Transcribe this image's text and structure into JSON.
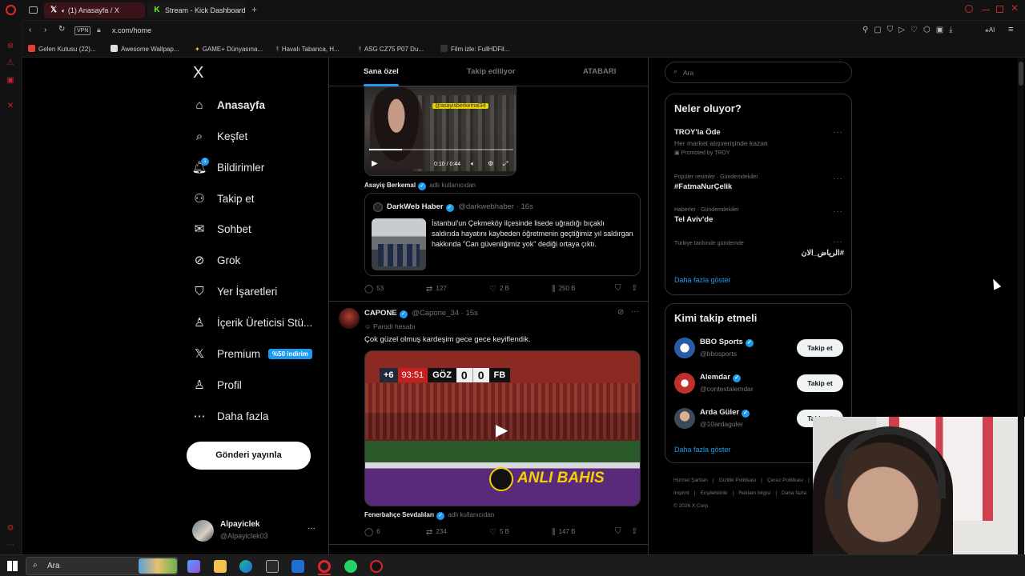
{
  "browser": {
    "tabs": [
      {
        "label": "(1) Anasayfa / X",
        "active": true
      },
      {
        "label": "Stream - Kick Dashboard",
        "active": false
      }
    ],
    "new_tab": "+",
    "url": "x.com/home",
    "vpn": "VPN",
    "ai_label": "AI",
    "bookmarks": [
      "Gelen Kutusu (22)...",
      "Awesome Wallpap...",
      "GAME+ Dünyasına...",
      "Havalı Tabanca, H...",
      "ASG CZ75 P07 Du...",
      "Film izle: FullHDFil..."
    ]
  },
  "nav": {
    "logo": "X",
    "items": [
      {
        "label": "Anasayfa",
        "icon": "home-icon",
        "glyph": "⌂"
      },
      {
        "label": "Keşfet",
        "icon": "search-icon",
        "glyph": "⌕"
      },
      {
        "label": "Bildirimler",
        "icon": "bell-icon",
        "glyph": "🔔︎"
      },
      {
        "label": "Takip et",
        "icon": "follow-person-icon",
        "glyph": "⚇"
      },
      {
        "label": "Sohbet",
        "icon": "mail-icon",
        "glyph": "✉"
      },
      {
        "label": "Grok",
        "icon": "grok-icon",
        "glyph": "⊘"
      },
      {
        "label": "Yer İşaretleri",
        "icon": "bookmark-icon",
        "glyph": "⛉"
      },
      {
        "label": "İçerik Üreticisi Stü...",
        "icon": "creator-studio-icon",
        "glyph": "♙"
      },
      {
        "label": "Premium",
        "icon": "x-premium-icon",
        "glyph": "𝕏"
      },
      {
        "label": "Profil",
        "icon": "profile-icon",
        "glyph": "♙"
      },
      {
        "label": "Daha fazla",
        "icon": "more-circle-icon",
        "glyph": "⋯"
      }
    ],
    "premium_badge": "%50 indirim",
    "notification_count": "1",
    "post_button": "Gönderi yayınla",
    "account": {
      "name": "Alpayiclek",
      "handle": "@Alpayiclek03"
    }
  },
  "timeline": {
    "tabs": [
      "Sana özel",
      "Takip ediliyor",
      "ATABARI"
    ],
    "tweet1": {
      "video_overlay_tag": "@asayisberkemal34",
      "video_time": "0:10 / 0:44",
      "attribution_name": "Asayiş Berkemal",
      "attribution_suffix": "adlı kullanıcıdan",
      "quote": {
        "name": "DarkWeb Haber",
        "handle": "@darkwebhaber",
        "time": "· 16s",
        "text": "İstanbul'un Çekmeköy ilçesinde lisede uğradığı bıçaklı saldırıda hayatını kaybeden öğretmenin geçtiğimiz yıl saldırgan hakkında \"Can güvenliğimiz yok\" dediği ortaya çıktı."
      },
      "stats": {
        "replies": "53",
        "reposts": "127",
        "likes": "2 B",
        "views": "250 B"
      }
    },
    "tweet2": {
      "name": "CAPONE",
      "handle": "@Capone_34",
      "time": "· 15s",
      "parody": "Parodi hesabı",
      "text": "Çok güzel olmuş kardeşim gece gece keyiflendik.",
      "scoreboard": {
        "plus": "+6",
        "clock": "93:51",
        "home": "GÖZ",
        "home_score": "0",
        "away_score": "0",
        "away": "FB"
      },
      "pitch_text": "ANLI BAHIS",
      "attribution_name": "Fenerbahçe Sevdalıları",
      "attribution_suffix": "adlı kullanıcıdan",
      "stats": {
        "replies": "6",
        "reposts": "234",
        "likes": "5 B",
        "views": "147 B"
      }
    }
  },
  "right": {
    "search_placeholder": "Ara",
    "trends": {
      "title": "Neler oluyor?",
      "items": [
        {
          "meta": "",
          "title": "TROY'la Öde",
          "sub": "Her market alışverişinde kazan",
          "promo": "Promoted by TROY"
        },
        {
          "meta": "Popüler resimler · Gündemdekiler",
          "title": "#FatmaNurÇelik"
        },
        {
          "meta": "Haberler · Gündemdekiler",
          "title": "Tel Aviv'de"
        },
        {
          "meta": "Türkiye tarihinde gündemde",
          "title": "#الرياض_الان"
        }
      ],
      "show_more": "Daha fazla göster"
    },
    "who_to_follow": {
      "title": "Kimi takip etmeli",
      "users": [
        {
          "name": "BBO Sports",
          "handle": "@bbosports"
        },
        {
          "name": "Alemdar",
          "handle": "@contextalemdar"
        },
        {
          "name": "Arda Güler",
          "handle": "@10ardaguler"
        }
      ],
      "follow_label": "Takip et",
      "show_more": "Daha fazla göster"
    },
    "footer": {
      "links": [
        "Hizmet Şartları",
        "|",
        "Gizlilik Politikası",
        "|",
        "Çerez Politikası",
        "|"
      ],
      "links2": [
        "Imprint",
        "|",
        "Erişilebilirlik",
        "|",
        "Reklam bilgisi",
        "|",
        "Daha fazla"
      ],
      "copyright": "© 2026 X Corp."
    }
  },
  "taskbar": {
    "search_placeholder": "Ara"
  },
  "colors": {
    "accent": "#1d9bf0",
    "opera_red": "#c2282e",
    "background": "#000000",
    "border": "#2f3336"
  }
}
